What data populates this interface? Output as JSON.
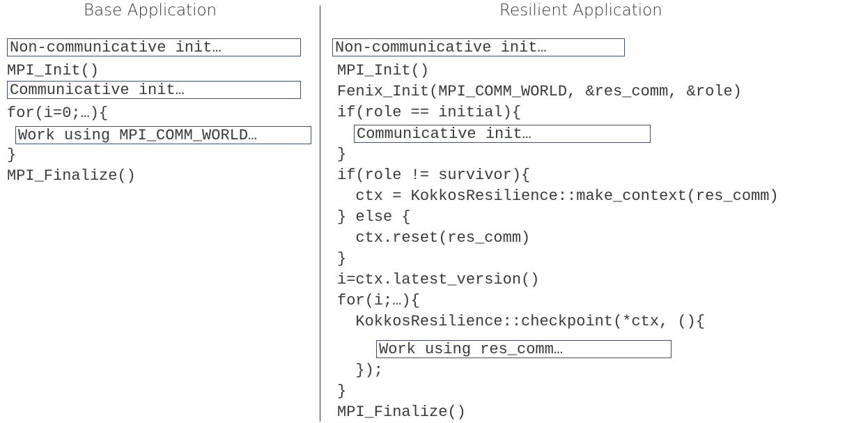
{
  "left": {
    "heading": "Base Application",
    "lines": {
      "noncomm_init": "Non-communicative init…",
      "mpi_init": "MPI_Init()",
      "comm_init": "Communicative init…",
      "for_loop": "for(i=0;…){",
      "work": "Work using MPI_COMM_WORLD…",
      "close_brace": "}",
      "mpi_finalize": "MPI_Finalize()"
    }
  },
  "right": {
    "heading": "Resilient Application",
    "lines": {
      "noncomm_init": "Non-communicative init…",
      "mpi_init": "MPI_Init()",
      "fenix_init": "Fenix_Init(MPI_COMM_WORLD, &res_comm, &role)",
      "if_initial": "if(role == initial){",
      "comm_init": "Communicative init…",
      "close_brace_1": "}",
      "if_survivor": "if(role != survivor){",
      "make_context": "  ctx = KokkosResilience::make_context(res_comm)",
      "else": "} else {",
      "reset": "  ctx.reset(res_comm)",
      "close_brace_2": "}",
      "latest_version": "i=ctx.latest_version()",
      "for_loop": "for(i;…){",
      "checkpoint": "  KokkosResilience::checkpoint(*ctx, (){",
      "work": "Work using res_comm…",
      "close_lambda": "  });",
      "close_brace_3": "}",
      "mpi_finalize": "MPI_Finalize()"
    }
  }
}
